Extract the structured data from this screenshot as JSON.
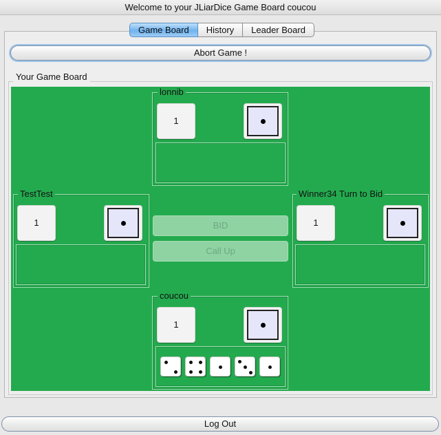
{
  "window": {
    "title": "Welcome to your JLiarDice Game Board coucou"
  },
  "tabs": [
    {
      "label": "Game Board",
      "active": true
    },
    {
      "label": "History",
      "active": false
    },
    {
      "label": "Leader Board",
      "active": false
    }
  ],
  "abort_label": "Abort Game !",
  "board": {
    "group_label": "Your Game Board",
    "background": "#24aa4e",
    "players": {
      "top": {
        "name": "lonnib",
        "bid_count": "1",
        "bid_face": 1
      },
      "left": {
        "name": "TestTest",
        "bid_count": "1",
        "bid_face": 1
      },
      "right": {
        "name": "Winner34 Turn to Bid",
        "bid_count": "1",
        "bid_face": 1
      },
      "bottom": {
        "name": "coucou",
        "bid_count": "1",
        "bid_face": 1,
        "dice": [
          2,
          4,
          1,
          3,
          1
        ]
      }
    },
    "actions": {
      "bid_label": "BID",
      "call_up_label": "Call Up",
      "enabled": false
    }
  },
  "logout_label": "Log Out"
}
